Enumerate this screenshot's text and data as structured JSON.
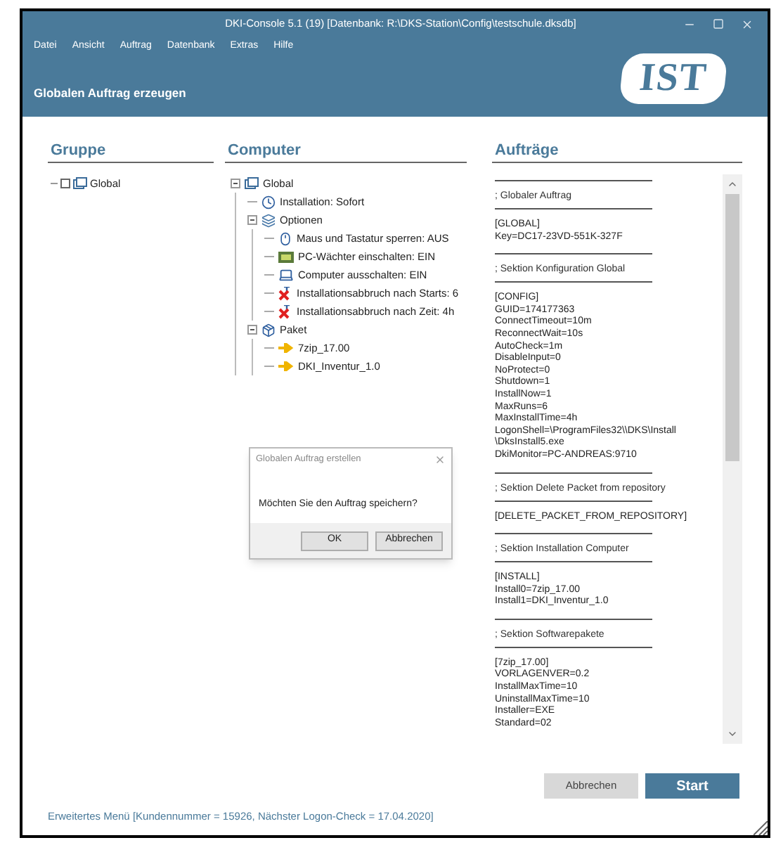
{
  "window": {
    "title": "DKI-Console 5.1 (19) [Datenbank: R:\\DKS-Station\\Config\\testschule.dksdb]"
  },
  "menu": [
    "Datei",
    "Ansicht",
    "Auftrag",
    "Datenbank",
    "Extras",
    "Hilfe"
  ],
  "page_title": "Globalen Auftrag erzeugen",
  "logo": {
    "text": "IST"
  },
  "group_panel": {
    "heading": "Gruppe",
    "items": [
      {
        "label": "Global",
        "checked": false
      }
    ]
  },
  "computer_panel": {
    "heading": "Computer",
    "tree": [
      {
        "label": "Global",
        "kind": "group",
        "expanded": true,
        "children": [
          {
            "label": "Installation: Sofort",
            "kind": "clock"
          },
          {
            "label": "Optionen",
            "kind": "options",
            "expanded": true,
            "children": [
              {
                "label": "Maus und Tastatur sperren: AUS",
                "kind": "mouse"
              },
              {
                "label": "PC-Wächter einschalten: EIN",
                "kind": "guard"
              },
              {
                "label": "Computer ausschalten: EIN",
                "kind": "laptop"
              },
              {
                "label": "Installationsabbruch nach Starts: 6",
                "kind": "cancel"
              },
              {
                "label": "Installationsabbruch nach Zeit: 4h",
                "kind": "cancel"
              }
            ]
          },
          {
            "label": "Paket",
            "kind": "package",
            "expanded": true,
            "children": [
              {
                "label": "7zip_17.00",
                "kind": "arrow"
              },
              {
                "label": "DKI_Inventur_1.0",
                "kind": "arrow"
              }
            ]
          }
        ]
      }
    ]
  },
  "orders_panel": {
    "heading": "Aufträge",
    "blocks": [
      {
        "kind": "section",
        "text": "; Globaler Auftrag"
      },
      {
        "kind": "lines",
        "lines": [
          "[GLOBAL]",
          "Key=DC17-23VD-551K-327F"
        ]
      },
      {
        "kind": "section",
        "text": "; Sektion Konfiguration Global"
      },
      {
        "kind": "lines",
        "lines": [
          "[CONFIG]",
          "GUID=174177363",
          "ConnectTimeout=10m",
          "ReconnectWait=10s",
          "AutoCheck=1m",
          "DisableInput=0",
          "NoProtect=0",
          "Shutdown=1",
          "InstallNow=1",
          "MaxRuns=6",
          "MaxInstallTime=4h",
          "LogonShell=\\ProgramFiles32\\\\DKS\\Install",
          "\\DksInstall5.exe",
          "DkiMonitor=PC-ANDREAS:9710"
        ]
      },
      {
        "kind": "section",
        "text": "; Sektion Delete Packet from repository"
      },
      {
        "kind": "lines",
        "lines": [
          "[DELETE_PACKET_FROM_REPOSITORY]"
        ]
      },
      {
        "kind": "section",
        "text": "; Sektion Installation Computer"
      },
      {
        "kind": "lines",
        "lines": [
          "[INSTALL]",
          "Install0=7zip_17.00",
          "Install1=DKI_Inventur_1.0"
        ]
      },
      {
        "kind": "section",
        "text": "; Sektion Softwarepakete"
      },
      {
        "kind": "lines",
        "lines": [
          "[7zip_17.00]",
          "VORLAGENVER=0.2",
          "InstallMaxTime=10",
          "UninstallMaxTime=10",
          "Installer=EXE",
          "Standard=02"
        ]
      }
    ]
  },
  "buttons": [
    {
      "label": "Abbrechen",
      "kind": "secondary"
    },
    {
      "label": "Start",
      "kind": "primary"
    }
  ],
  "status_text": "Erweitertes Menü [Kundennummer = 15926, Nächster Logon-Check = 17.04.2020]",
  "dialog": {
    "title": "Globalen Auftrag erstellen",
    "message": "Möchten Sie den Auftrag speichern?",
    "buttons": [
      "OK",
      "Abbrechen"
    ]
  }
}
